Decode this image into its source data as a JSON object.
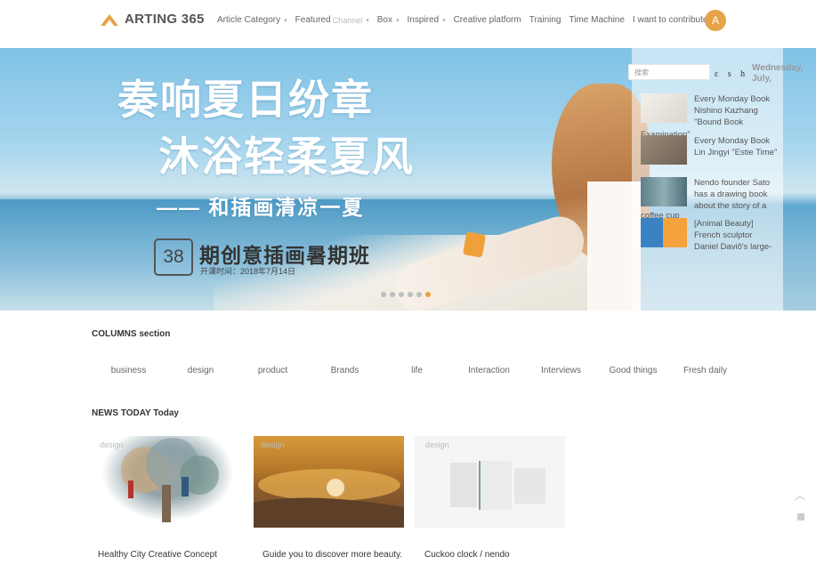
{
  "header": {
    "logo_text": "ARTING 365",
    "avatar_letter": "A",
    "nav": [
      {
        "label": "Article Category",
        "sub": "",
        "chevron": true
      },
      {
        "label": "Featured",
        "sub": "Channel",
        "chevron": true
      },
      {
        "label": "Box",
        "sub": "",
        "chevron": true
      },
      {
        "label": "Inspired",
        "sub": "",
        "chevron": true
      },
      {
        "label": "Creative platform",
        "sub": "",
        "chevron": false
      },
      {
        "label": "Training",
        "sub": "",
        "chevron": false
      },
      {
        "label": "Time Machine",
        "sub": "",
        "chevron": false
      },
      {
        "label": "I want to contribute",
        "sub": "",
        "chevron": false
      }
    ]
  },
  "banner": {
    "title_line1": "奏响夏日纷章",
    "title_line2": "沐浴轻柔夏风",
    "title_line3": "—— 和插画清凉一夏",
    "issue_number": "38",
    "issue_title": "期创意插画暑期班",
    "issue_date": "开课时间：2018年7月14日",
    "slide_count": 6,
    "active_slide": 5
  },
  "side_panel": {
    "search_placeholder": "搜索",
    "glyphs": "ε s h",
    "date_text": "Wednesday, July,",
    "articles": [
      {
        "text": "Every Monday Book Nishino Kazhang \"Bound Book",
        "overflow": "Examination\""
      },
      {
        "text": "Every Monday Book Lin Jingyi \"Estie Time\"",
        "overflow": ""
      },
      {
        "text": "Nendo founder Sato has a drawing book about the story of a",
        "overflow": "coffee cup"
      },
      {
        "text": "[Animal Beauty] French sculptor Daniel Daviô's large-",
        "overflow": ""
      }
    ]
  },
  "columns": {
    "title": "COLUMNS section",
    "items": [
      "business",
      "design",
      "product",
      "Brands",
      "life",
      "Interaction",
      "Interviews",
      "Good things",
      "Fresh daily"
    ]
  },
  "news": {
    "title": "NEWS TODAY Today",
    "cards": [
      {
        "tag": "design",
        "title": "Healthy City Creative Concept"
      },
      {
        "tag": "design",
        "title": "Guide you to discover more beauty."
      },
      {
        "tag": "design",
        "title": "Cuckoo clock / nendo"
      }
    ]
  },
  "colors": {
    "accent": "#e6a34a",
    "text": "#333333",
    "muted": "#666666"
  },
  "icons": {
    "logo": "logo-mark-icon",
    "chevron": "chevron-down-icon",
    "scroll_top": "chevron-up-icon"
  }
}
